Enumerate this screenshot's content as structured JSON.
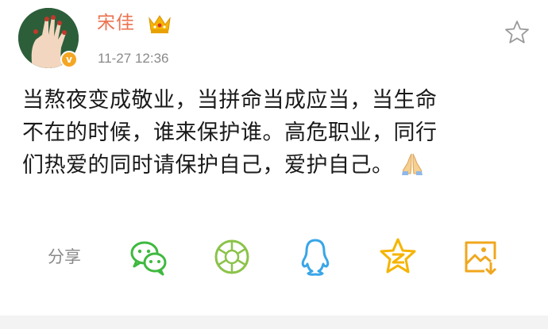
{
  "post": {
    "author": "宋佳",
    "timestamp": "11-27 12:36",
    "content_lines": [
      "当熬夜变成敬业，当拼命当成应当，当生命",
      "不在的时候，谁来保护谁。高危职业，同行",
      "们热爱的同时请保护自己，爱护自己。"
    ],
    "emoji": "pray-icon"
  },
  "share": {
    "label": "分享",
    "targets": [
      {
        "name": "wechat-icon",
        "color": "#3fb93f"
      },
      {
        "name": "wechat-moments-icon",
        "color": "#8bc34a"
      },
      {
        "name": "qq-icon",
        "color": "#3aa6e8"
      },
      {
        "name": "qzone-icon",
        "color": "#f5b400"
      },
      {
        "name": "save-image-icon",
        "color": "#f0a71e"
      }
    ]
  },
  "colors": {
    "author": "#eb7350",
    "timestamp": "#8a8a8a",
    "text": "#1a1a1a"
  }
}
